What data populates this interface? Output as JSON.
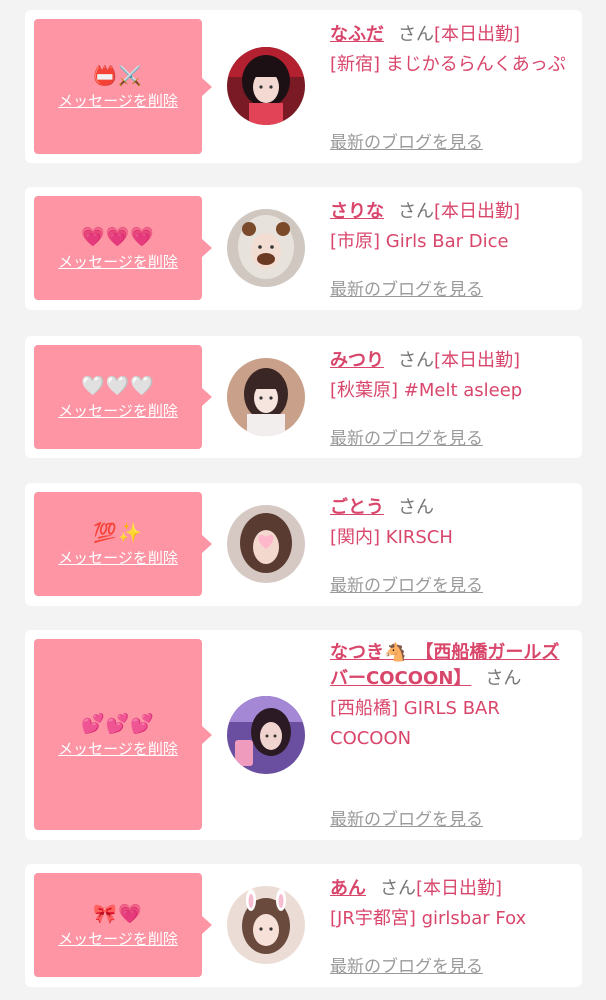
{
  "delete_label": "メッセージを削除",
  "blog_label": "最新のブログを見る",
  "suffix": "さん",
  "accent_color": "#d9466b",
  "message_bg": "#fe95a4",
  "cards": [
    {
      "emoji": "📛⚔️",
      "name": "なふだ",
      "status": "[本日出勤]",
      "shop": "[新宿] まじかるらんくあっぷ"
    },
    {
      "emoji": "💗💗💗",
      "name": "さりな",
      "status": "[本日出勤]",
      "shop": "[市原] Girls Bar Dice"
    },
    {
      "emoji": "🤍🤍🤍",
      "name": "みつり",
      "status": "[本日出勤]",
      "shop": "[秋葉原] #Melt asleep"
    },
    {
      "emoji": "💯✨",
      "name": "ごとう",
      "status": "",
      "shop": "[関内] KIRSCH"
    },
    {
      "emoji": "💕💕💕",
      "name": "なつき🐴　【西船橋ガールズバーCOCOON】",
      "status": "",
      "shop": "[西船橋] GIRLS BAR COCOON"
    },
    {
      "emoji": "🎀💗",
      "name": "あん",
      "status": "[本日出勤]",
      "shop": "[JR宇都宮] girlsbar Fox"
    }
  ]
}
